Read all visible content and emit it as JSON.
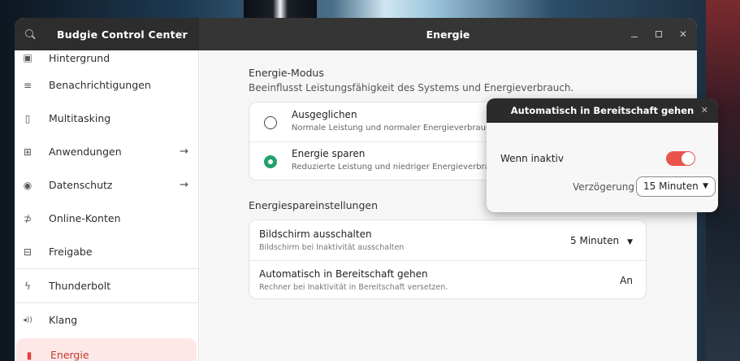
{
  "app": {
    "title": "Budgie Control Center",
    "menu": "···"
  },
  "panel": {
    "title": "Energie"
  },
  "sidebar": {
    "items": [
      {
        "label": "Hintergrund",
        "icon": "wallpaper-icon",
        "glyph": "▣"
      },
      {
        "label": "Benachrichtigungen",
        "icon": "notification-icon",
        "glyph": "≡"
      },
      {
        "label": "Multitasking",
        "icon": "multitasking-icon",
        "glyph": "▯"
      },
      {
        "label": "Anwendungen",
        "icon": "apps-icon",
        "glyph": "⊞",
        "arrow": "→"
      },
      {
        "label": "Datenschutz",
        "icon": "privacy-icon",
        "glyph": "◉",
        "arrow": "→"
      },
      {
        "label": "Online-Konten",
        "icon": "online-accounts-icon",
        "glyph": "⊅"
      },
      {
        "label": "Freigabe",
        "icon": "sharing-icon",
        "glyph": "⊟"
      },
      {
        "label": "Thunderbolt",
        "icon": "thunderbolt-icon",
        "glyph": "ϟ"
      },
      {
        "label": "Klang",
        "icon": "sound-icon",
        "glyph": "◂))"
      },
      {
        "label": "Energie",
        "icon": "power-icon",
        "glyph": "▮"
      }
    ]
  },
  "energy_mode": {
    "title": "Energie-Modus",
    "subtitle": "Beeinflusst Leistungsfähigkeit des Systems und Energieverbrauch.",
    "options": [
      {
        "title": "Ausgeglichen",
        "subtitle": "Normale Leistung und normaler Energieverbrauch",
        "selected": false
      },
      {
        "title": "Energie sparen",
        "subtitle": "Reduzierte Leistung und niedriger Energieverbrauch",
        "selected": true
      }
    ]
  },
  "power_saving": {
    "title": "Energiespareinstellungen",
    "rows": [
      {
        "title": "Bildschirm ausschalten",
        "subtitle": "Bildschirm bei Inaktivität ausschalten",
        "value": "5 Minuten",
        "caret": "▼"
      },
      {
        "title": "Automatisch in Bereitschaft gehen",
        "subtitle": "Rechner bei Inaktivität in Bereitschaft versetzen.",
        "value": "An"
      }
    ]
  },
  "popup": {
    "title": "Automatisch in Bereitschaft gehen",
    "close": "✕",
    "toggle_label": "Wenn inaktiv",
    "toggle_on": true,
    "delay_label": "Verzögerung",
    "delay_value": "15 Minuten",
    "caret": "▼"
  },
  "colors": {
    "accent": "#e8544b",
    "active_bg": "#fde8e7",
    "radio_on": "#22a06b"
  }
}
